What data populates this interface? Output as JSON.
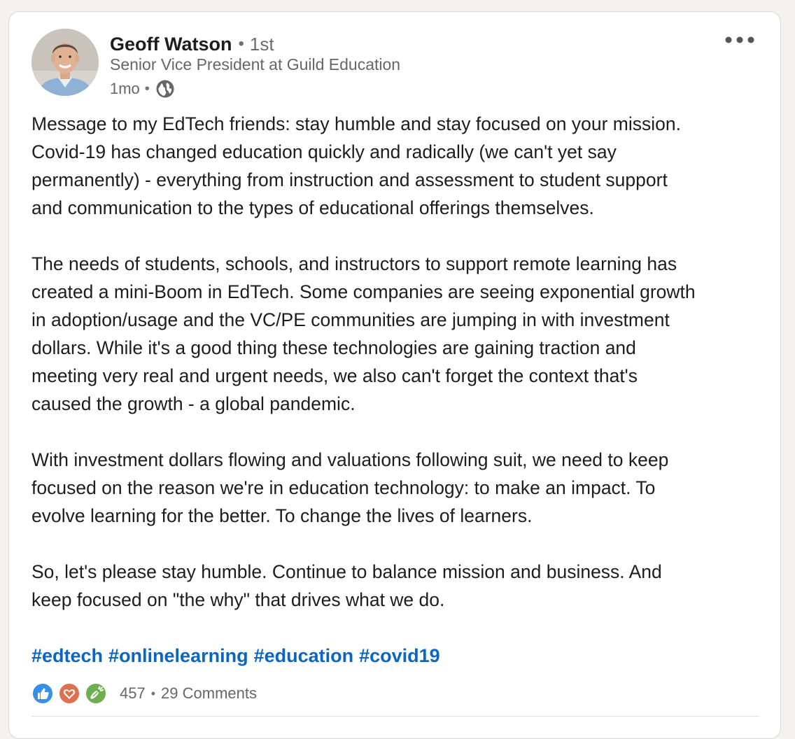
{
  "post": {
    "author": {
      "name": "Geoff Watson",
      "degree": "1st",
      "headline": "Senior Vice President at Guild Education",
      "time": "1mo",
      "visibility_icon": "globe-icon"
    },
    "more_icon": "ellipsis-icon",
    "paragraphs": [
      {
        "lines": [
          "Message to my EdTech friends: stay humble and stay focused on your mission.",
          "Covid-19 has changed education quickly and radically (we can't yet say",
          "permanently) - everything from instruction and assessment to student support",
          "and communication to the types of educational offerings themselves."
        ]
      },
      {
        "lines": [
          "The needs of students, schools, and instructors to support remote learning has",
          "created a mini-Boom in EdTech. Some companies are seeing exponential growth",
          "in adoption/usage and the VC/PE communities are jumping in with investment",
          "dollars. While it's a good thing these technologies are gaining traction and",
          "meeting very real and urgent needs, we also can't forget the context that's",
          "caused the growth - a global pandemic."
        ]
      },
      {
        "lines": [
          "With investment dollars flowing and valuations following suit, we need to keep",
          "focused on the reason we're in education technology: to make an impact. To",
          "evolve learning for the better. To change the lives of learners."
        ]
      },
      {
        "lines": [
          "So, let's please stay humble. Continue to balance mission and business. And",
          "keep focused on \"the why\" that drives what we do."
        ]
      }
    ],
    "hashtags": [
      "#edtech",
      "#onlinelearning",
      "#education",
      "#covid19"
    ],
    "reactions": {
      "icons": [
        "like-icon",
        "love-icon",
        "celebrate-icon"
      ],
      "count": "457",
      "comments": "29 Comments"
    }
  },
  "colors": {
    "link": "#0a66c2",
    "like": "#378fe9",
    "love": "#df704d",
    "celebrate": "#6dae4f"
  }
}
